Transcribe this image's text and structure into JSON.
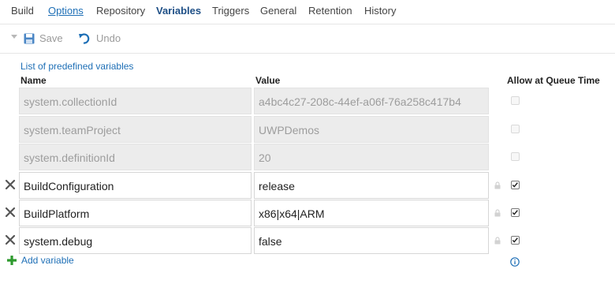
{
  "tabs": [
    {
      "label": "Build"
    },
    {
      "label": "Options"
    },
    {
      "label": "Repository"
    },
    {
      "label": "Variables"
    },
    {
      "label": "Triggers"
    },
    {
      "label": "General"
    },
    {
      "label": "Retention"
    },
    {
      "label": "History"
    }
  ],
  "toolbar": {
    "save_label": "Save",
    "undo_label": "Undo"
  },
  "predefined_link": "List of predefined variables",
  "columns": {
    "name": "Name",
    "value": "Value",
    "queue": "Allow at Queue Time"
  },
  "predefined": [
    {
      "name": "system.collectionId",
      "value": "a4bc4c27-208c-44ef-a06f-76a258c417b4",
      "allow_queue_time": false
    },
    {
      "name": "system.teamProject",
      "value": "UWPDemos",
      "allow_queue_time": false
    },
    {
      "name": "system.definitionId",
      "value": "20",
      "allow_queue_time": false
    }
  ],
  "variables": [
    {
      "name": "BuildConfiguration",
      "value": "release",
      "allow_queue_time": true
    },
    {
      "name": "BuildPlatform",
      "value": "x86|x64|ARM",
      "allow_queue_time": true
    },
    {
      "name": "system.debug",
      "value": "false",
      "allow_queue_time": true
    }
  ],
  "add_variable_label": "Add variable",
  "colors": {
    "accent": "#1e6fb6",
    "active_tab": "#1e4f86",
    "add_icon": "#2e9a2e",
    "readonly_bg": "#ececec"
  }
}
